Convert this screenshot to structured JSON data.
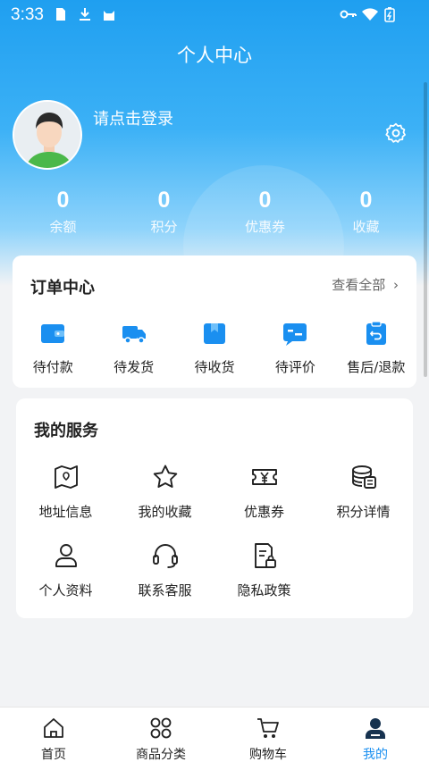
{
  "status_bar": {
    "time": "3:33"
  },
  "header": {
    "title": "个人中心"
  },
  "profile": {
    "login_text": "请点击登录"
  },
  "stats": [
    {
      "value": "0",
      "label": "余额"
    },
    {
      "value": "0",
      "label": "积分"
    },
    {
      "value": "0",
      "label": "优惠券"
    },
    {
      "value": "0",
      "label": "收藏"
    }
  ],
  "orders": {
    "title": "订单中心",
    "view_all": "查看全部",
    "items": [
      {
        "label": "待付款",
        "icon": "wallet-icon"
      },
      {
        "label": "待发货",
        "icon": "truck-icon"
      },
      {
        "label": "待收货",
        "icon": "box-icon"
      },
      {
        "label": "待评价",
        "icon": "review-icon"
      },
      {
        "label": "售后/退款",
        "icon": "refund-icon"
      }
    ]
  },
  "services": {
    "title": "我的服务",
    "items": [
      {
        "label": "地址信息",
        "icon": "map-icon"
      },
      {
        "label": "我的收藏",
        "icon": "star-icon"
      },
      {
        "label": "优惠券",
        "icon": "ticket-icon"
      },
      {
        "label": "积分详情",
        "icon": "coins-icon"
      },
      {
        "label": "个人资料",
        "icon": "user-icon"
      },
      {
        "label": "联系客服",
        "icon": "headset-icon"
      },
      {
        "label": "隐私政策",
        "icon": "policy-lock-icon"
      }
    ]
  },
  "tabbar": {
    "items": [
      {
        "label": "首页",
        "icon": "home-icon"
      },
      {
        "label": "商品分类",
        "icon": "grid-icon"
      },
      {
        "label": "购物车",
        "icon": "cart-icon"
      },
      {
        "label": "我的",
        "icon": "person-icon"
      }
    ],
    "active_index": 3
  },
  "colors": {
    "accent": "#1a8ff0",
    "hero_top": "#1f9ff0"
  }
}
